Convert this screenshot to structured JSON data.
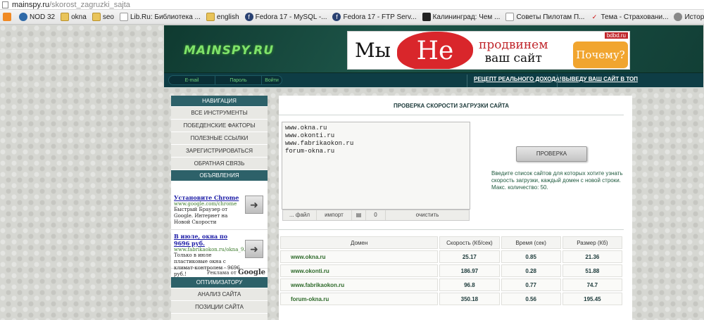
{
  "browser": {
    "url_host": "mainspy.ru",
    "url_path": "/skorost_zagruzki_sajta",
    "bookmarks": [
      {
        "label": "",
        "icon": "rss-icon"
      },
      {
        "label": "NOD 32",
        "icon": "nod32-icon"
      },
      {
        "label": "okna",
        "icon": "folder-icon"
      },
      {
        "label": "seo",
        "icon": "folder-icon"
      },
      {
        "label": "Lib.Ru: Библиотека ...",
        "icon": "page-icon"
      },
      {
        "label": "english",
        "icon": "folder-icon"
      },
      {
        "label": "Fedora 17 - MySQL -...",
        "icon": "fedora-icon"
      },
      {
        "label": "Fedora 17 - FTP Serv...",
        "icon": "fedora-icon"
      },
      {
        "label": "Калининград: Чем ...",
        "icon": "page-icon"
      },
      {
        "label": "Советы Пилотам П...",
        "icon": "page-icon"
      },
      {
        "label": "Тема - Страховани...",
        "icon": "page-icon"
      },
      {
        "label": "История заказов",
        "icon": "page-icon"
      }
    ]
  },
  "header": {
    "logo": "MAINSPY.RU",
    "banner": {
      "word1": "Мы",
      "word_ne": "Не",
      "line1": "продвинем",
      "line2": "ваш сайт",
      "why": "Почему?",
      "site": "bdbd.ru"
    }
  },
  "topbar": {
    "email_placeholder": "E-mail",
    "password_placeholder": "Пароль",
    "login_label": "Войти",
    "link1": "РЕЦЕПТ РЕАЛЬНОГО ДОХОДА!",
    "link2": "ВЫВЕДУ ВАШ САЙТ В ТОП"
  },
  "sidebar": {
    "nav_title": "НАВИГАЦИЯ",
    "nav_items": [
      "ВСЕ ИНСТРУМЕНТЫ",
      "ПОБЕДЕНСКИЕ ФАКТОРЫ",
      "ПОЛЕЗНЫЕ ССЫЛКИ",
      "ЗАРЕГИСТРИРОВАТЬСЯ",
      "ОБРАТНАЯ СВЯЗЬ"
    ],
    "ads_title": "ОБЪЯВЛЕНИЯ",
    "ads": [
      {
        "title": "Установите Chrome",
        "url": "www.google.com/chrome",
        "desc": "Быстрый Браузер от Google. Интернет на Новой Скорости"
      },
      {
        "title": "В июле, окна по 9696 руб.",
        "url": "www.fabrikaokon.ru/okna_9...",
        "desc": "Только в июле пластиковые окна с климат-контролем - 9696 руб.!"
      }
    ],
    "ads_by": "Реклама от",
    "google": "Google",
    "opt_title": "ОПТИМИЗАТОРУ",
    "opt_items": [
      "АНАЛИЗ САЙТА",
      "ПОЗИЦИИ САЙТА"
    ]
  },
  "main": {
    "title": "ПРОВЕРКА СКОРОСТИ ЗАГРУЗКИ САЙТА",
    "textarea_value": "www.okna.ru\nwww.okonti.ru\nwww.fabrikaokon.ru\nforum-okna.ru",
    "toolbar": {
      "file": "... файл",
      "import": "импорт",
      "count": "0",
      "clear": "очистить"
    },
    "check_button": "ПРОВЕРКА",
    "hint": "Введите список сайтов для которых хотите узнать скорость загрузки, каждый домен с новой строки. Макс. количество: 50.",
    "table": {
      "headers": [
        "Домен",
        "Скорость (Кб/сек)",
        "Время (сек)",
        "Размер (Кб)"
      ],
      "rows": [
        [
          "www.okna.ru",
          "25.17",
          "0.85",
          "21.36"
        ],
        [
          "www.okonti.ru",
          "186.97",
          "0.28",
          "51.88"
        ],
        [
          "www.fabrikaokon.ru",
          "96.8",
          "0.77",
          "74.7"
        ],
        [
          "forum-okna.ru",
          "350.18",
          "0.56",
          "195.45"
        ]
      ]
    }
  }
}
